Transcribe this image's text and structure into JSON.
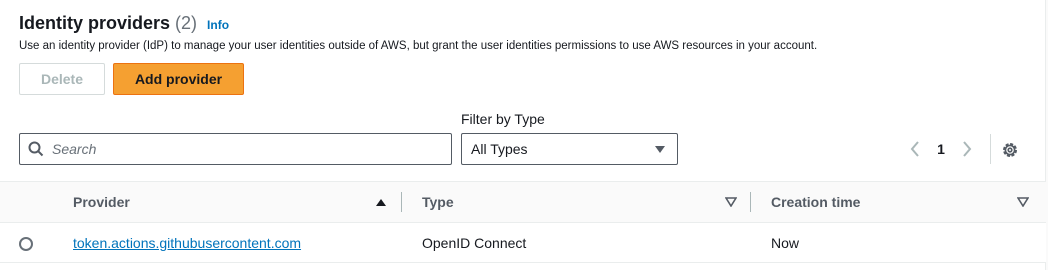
{
  "header": {
    "title": "Identity providers",
    "count": "(2)",
    "info_label": "Info",
    "description": "Use an identity provider (IdP) to manage your user identities outside of AWS, but grant the user identities permissions to use AWS resources in your account."
  },
  "actions": {
    "delete_label": "Delete",
    "add_label": "Add provider"
  },
  "filters": {
    "search_placeholder": "Search",
    "type_label": "Filter by Type",
    "type_selected": "All Types"
  },
  "pagination": {
    "current_page": "1"
  },
  "table": {
    "columns": [
      {
        "label": "Provider",
        "sort": "ascending"
      },
      {
        "label": "Type",
        "sort": "none"
      },
      {
        "label": "Creation time",
        "sort": "none"
      }
    ],
    "rows": [
      {
        "provider": "token.actions.githubusercontent.com",
        "type": "OpenID Connect",
        "created": "Now"
      }
    ]
  },
  "colors": {
    "primary_button": "#f5a031",
    "link": "#0073bb"
  }
}
